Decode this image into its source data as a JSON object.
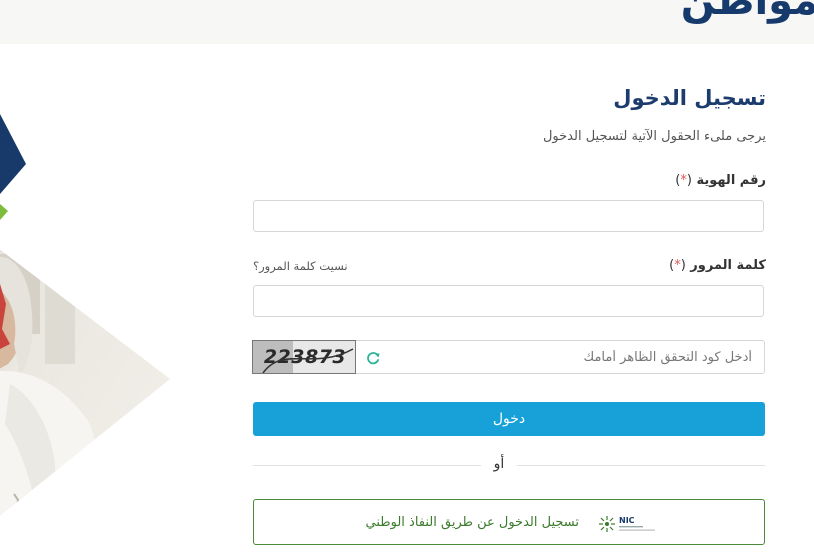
{
  "header": {
    "title": "مواطن"
  },
  "login": {
    "title": "تسجيل الدخول",
    "subtitle": "يرجى ملىء الحقول الآتية لتسجيل الدخول"
  },
  "fields": {
    "id_number": {
      "label": "رقم الهوية",
      "required_mark": "*",
      "value": "",
      "placeholder": ""
    },
    "password": {
      "label": "كلمة المرور",
      "required_mark": "*",
      "value": "",
      "placeholder": "",
      "forgot_link": "نسيت كلمة المرور؟"
    },
    "captcha": {
      "image_text": "223873",
      "value": "",
      "placeholder": "أدخل كود التحقق الظاهر أمامك",
      "refresh_icon": "refresh-icon"
    }
  },
  "actions": {
    "login_label": "دخول",
    "or_text": "أو",
    "nafath_label": "تسجيل الدخول عن طريق النفاذ الوطني",
    "nafath_logo_text": "NIC"
  },
  "colors": {
    "primary_navy": "#163a6b",
    "login_button": "#17a1d8",
    "nafath_green": "#4a8a3a",
    "required_red": "#e25555",
    "refresh_teal": "#2bb39a"
  }
}
